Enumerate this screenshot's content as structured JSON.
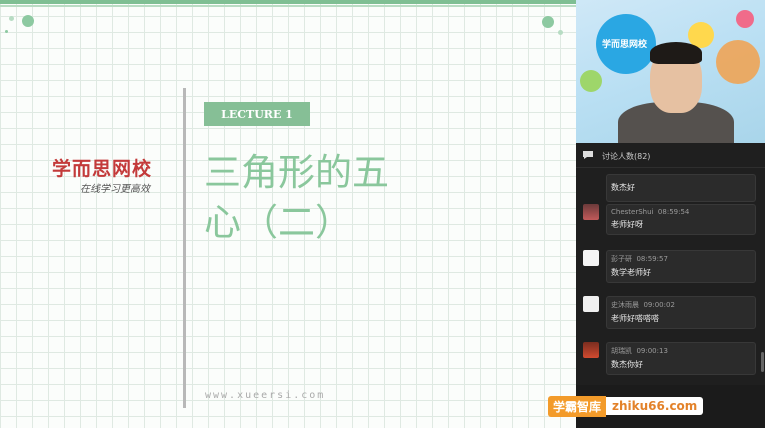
{
  "slide": {
    "brand": "学而思网校",
    "brand_tagline": "在线学习更高效",
    "lecture_label": "LECTURE 1",
    "title_line1": "三角形的五",
    "title_line2": "心（二）",
    "url": "www.xueersi.com"
  },
  "video": {
    "overlay_brand": "学而思网校"
  },
  "chat": {
    "header_label": "讨论人数(82)",
    "messages": [
      {
        "user": "",
        "time": "",
        "text": "数杰好"
      },
      {
        "user": "ChesterShui",
        "time": "08:59:54",
        "text": "老师好呀"
      },
      {
        "user": "彭子研",
        "time": "08:59:57",
        "text": "数学老师好"
      },
      {
        "user": "史沐雨晨",
        "time": "09:00:02",
        "text": "老师好嗒嗒嗒"
      },
      {
        "user": "胡瑞凯",
        "time": "09:00:13",
        "text": "数杰你好"
      }
    ]
  },
  "watermark": {
    "brand": "学霸智库",
    "site": "zhiku66.com"
  },
  "colors": {
    "accent_green": "#86bf96",
    "brand_red": "#c33a3a",
    "panel_bg": "#1f1f1f"
  }
}
